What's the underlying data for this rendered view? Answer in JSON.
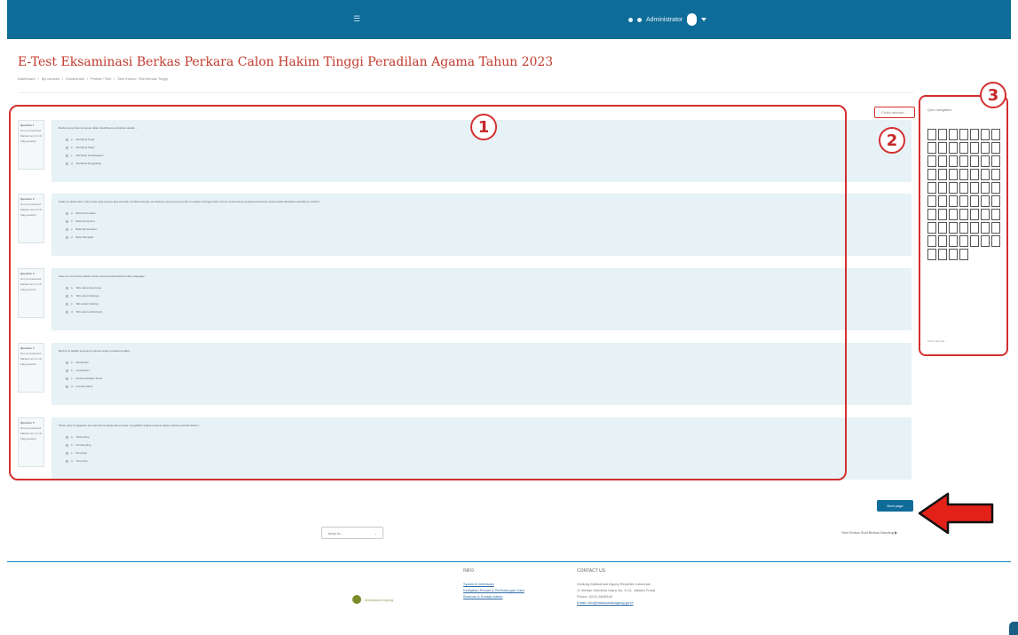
{
  "header": {
    "user_name": "Administrator"
  },
  "page": {
    "title": "E-Test Eksaminasi Berkas Perkara Calon Hakim Tinggi Peradilan Agama Tahun 2023",
    "breadcrumb": [
      "Dashboard",
      "My courses",
      "Eksaminasi",
      "Pretest / Test",
      "Sesi Kedua / Test Berkas Tinggi"
    ]
  },
  "questions": [
    {
      "number": "Question 1",
      "status": "Not yet answered",
      "marks": "Marked out of 1.00",
      "flag": "Flag question",
      "text": "Berikut yang tidak termasuk dalam klasifikasi pembuktian adalah ...",
      "options": [
        {
          "letter": "a.",
          "text": "Alat Bukti Surat"
        },
        {
          "letter": "b.",
          "text": "Alat Bukti Saksi"
        },
        {
          "letter": "c.",
          "text": "Alat Bukti Persangkaan"
        },
        {
          "letter": "d.",
          "text": "Alat Bukti Pengakuan"
        }
      ]
    },
    {
      "number": "Question 2",
      "status": "Not yet answered",
      "marks": "Marked out of 1.00",
      "flag": "Flag question",
      "text": "Dalam perkara waris, bukti surat yang berupa akta autentik memiliki kekuatan pembuktian yang sempurna dan mengikat sehingga hakim harus menerimanya sebagai kebenaran selama tidak dibuktikan sebaliknya, disebut ...",
      "options": [
        {
          "letter": "a.",
          "text": "Bukti Permulaan"
        },
        {
          "letter": "b.",
          "text": "Bukti Sempurna"
        },
        {
          "letter": "c.",
          "text": "Bukti Menentukan"
        },
        {
          "letter": "d.",
          "text": "Bukti Mengikat"
        }
      ]
    },
    {
      "number": "Question 3",
      "status": "Not yet answered",
      "marks": "Marked out of 1.00",
      "flag": "Flag question",
      "text": "Asas Ius Curia Novit dalam hukum acara perdata berarti hakim dianggap ...",
      "options": [
        {
          "letter": "a.",
          "text": "Tahu akan hukumnya"
        },
        {
          "letter": "b.",
          "text": "Tahu akan faktanya"
        },
        {
          "letter": "c.",
          "text": "Tahu akan buktinya"
        },
        {
          "letter": "d.",
          "text": "Tahu akan perkaranya"
        }
      ]
    },
    {
      "number": "Question 4",
      "status": "Not yet answered",
      "marks": "Marked out of 1.00",
      "flag": "Flag question",
      "text": "Berikut ini adalah jenis-jenis putusan dalam perkara perdata ...",
      "options": [
        {
          "letter": "a.",
          "text": "Declaratoir"
        },
        {
          "letter": "b.",
          "text": "Constitutief"
        },
        {
          "letter": "c.",
          "text": "Semua jawaban benar"
        },
        {
          "letter": "d.",
          "text": "Condemnatoir"
        }
      ]
    },
    {
      "number": "Question 5",
      "status": "Not yet answered",
      "marks": "Marked out of 1.00",
      "flag": "Flag question",
      "text": "Pihak yang mengajukan permohonan banding atas putusan pengadilan tingkat pertama dalam perkara perdata disebut ...",
      "options": [
        {
          "letter": "a.",
          "text": "Terbanding"
        },
        {
          "letter": "b.",
          "text": "Pembanding"
        },
        {
          "letter": "c.",
          "text": "Pemohon"
        },
        {
          "letter": "d.",
          "text": "Termohon"
        }
      ]
    }
  ],
  "finish_link": "Finish attempt ...",
  "quiz_nav": {
    "title": "Quiz navigation",
    "finish": "Finish attempt ..."
  },
  "callouts": [
    "1",
    "2",
    "3"
  ],
  "next_button": "Next page",
  "jump_select": {
    "value": "Jump to..."
  },
  "next_activity": "Sesi Kedua Soal Berkas Banding ▶",
  "footer": {
    "logo_text": "Mahkamah Agung",
    "col1_title": "INFO",
    "col1_links": [
      "Syarat & Ketentuan",
      "Kebijakan Privasi & Perlindungan Data",
      "Bantuan & Kontak Admin"
    ],
    "col2_title": "CONTACT US",
    "col2_lines": [
      "Gedung Mahkamah Agung Republik Indonesia",
      "Jl. Medan Merdeka Utara No. 9-13, Jakarta Pusat",
      "Phone: (021) 3843348",
      "Email: info@mahkamahagung.go.id"
    ]
  },
  "accent_colors": {
    "header": "#0f6c99",
    "title": "#c0392b",
    "annotation": "#d32f2f"
  }
}
